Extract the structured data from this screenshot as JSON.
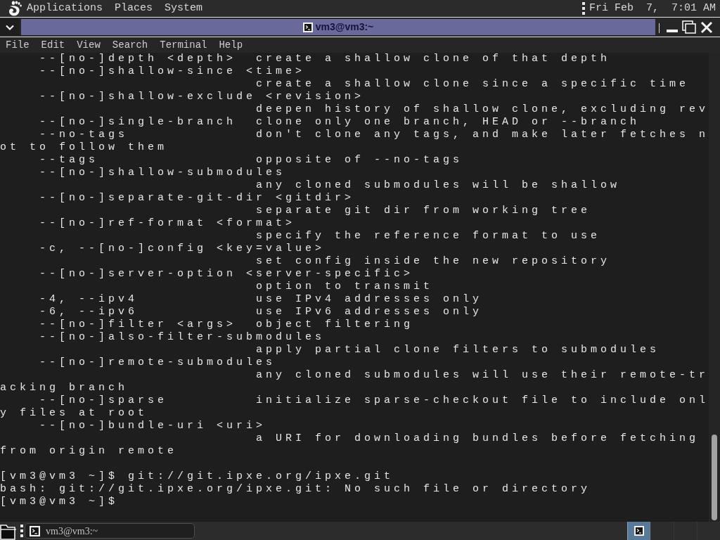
{
  "top_panel": {
    "menus": [
      "Applications",
      "Places",
      "System"
    ],
    "clock": "Fri Feb  7,  7:01 AM"
  },
  "window": {
    "title": "vm3@vm3:~"
  },
  "menu_bar": [
    "File",
    "Edit",
    "View",
    "Search",
    "Terminal",
    "Help"
  ],
  "terminal": {
    "lines": [
      {
        "kind": "option",
        "option": "--[no-]depth <depth>",
        "description": "create a shallow clone of that depth"
      },
      {
        "kind": "option",
        "option": "--[no-]shallow-since <time>"
      },
      {
        "kind": "description",
        "text": "create a shallow clone since a specific time"
      },
      {
        "kind": "option",
        "option": "--[no-]shallow-exclude <revision>"
      },
      {
        "kind": "description",
        "text": "deepen history of shallow clone, excluding rev"
      },
      {
        "kind": "option",
        "option": "--[no-]single-branch",
        "description": "clone only one branch, HEAD or --branch"
      },
      {
        "kind": "option",
        "option": "--no-tags",
        "description": "don't clone any tags, and make later fetches n"
      },
      {
        "kind": "plain",
        "text": "ot to follow them"
      },
      {
        "kind": "option",
        "option": "--tags",
        "description": "opposite of --no-tags"
      },
      {
        "kind": "option",
        "option": "--[no-]shallow-submodules"
      },
      {
        "kind": "description",
        "text": "any cloned submodules will be shallow"
      },
      {
        "kind": "option",
        "option": "--[no-]separate-git-dir <gitdir>"
      },
      {
        "kind": "description",
        "text": "separate git dir from working tree"
      },
      {
        "kind": "option",
        "option": "--[no-]ref-format <format>"
      },
      {
        "kind": "description",
        "text": "specify the reference format to use"
      },
      {
        "kind": "option",
        "option": "-c, --[no-]config <key=value>"
      },
      {
        "kind": "description",
        "text": "set config inside the new repository"
      },
      {
        "kind": "option",
        "option": "--[no-]server-option <server-specific>"
      },
      {
        "kind": "description",
        "text": "option to transmit"
      },
      {
        "kind": "option",
        "option": "-4, --ipv4",
        "description": "use IPv4 addresses only"
      },
      {
        "kind": "option",
        "option": "-6, --ipv6",
        "description": "use IPv6 addresses only"
      },
      {
        "kind": "option",
        "option": "--[no-]filter <args>",
        "description": "object filtering"
      },
      {
        "kind": "option",
        "option": "--[no-]also-filter-submodules"
      },
      {
        "kind": "description",
        "text": "apply partial clone filters to submodules"
      },
      {
        "kind": "option",
        "option": "--[no-]remote-submodules"
      },
      {
        "kind": "description",
        "text": "any cloned submodules will use their remote-tr"
      },
      {
        "kind": "plain",
        "text": "acking branch"
      },
      {
        "kind": "option",
        "option": "--[no-]sparse",
        "description": "initialize sparse-checkout file to include onl"
      },
      {
        "kind": "plain",
        "text": "y files at root"
      },
      {
        "kind": "option",
        "option": "--[no-]bundle-uri <uri>"
      },
      {
        "kind": "description",
        "text": "a URI for downloading bundles before fetching"
      },
      {
        "kind": "plain",
        "text": "from origin remote"
      },
      {
        "kind": "blank"
      },
      {
        "kind": "prompt",
        "prompt": "[vm3@vm3 ~]$",
        "command": "git://git.ipxe.org/ipxe.git"
      },
      {
        "kind": "plain",
        "text": "bash: git://git.ipxe.org/ipxe.git: No such file or directory"
      },
      {
        "kind": "prompt",
        "prompt": "[vm3@vm3 ~]$"
      }
    ]
  },
  "taskbar": {
    "tasks": [
      {
        "label": "vm3@vm3:~"
      }
    ],
    "workspaces": [
      {
        "selected": true
      },
      {
        "selected": false
      },
      {
        "selected": false
      },
      {
        "selected": false
      }
    ]
  }
}
